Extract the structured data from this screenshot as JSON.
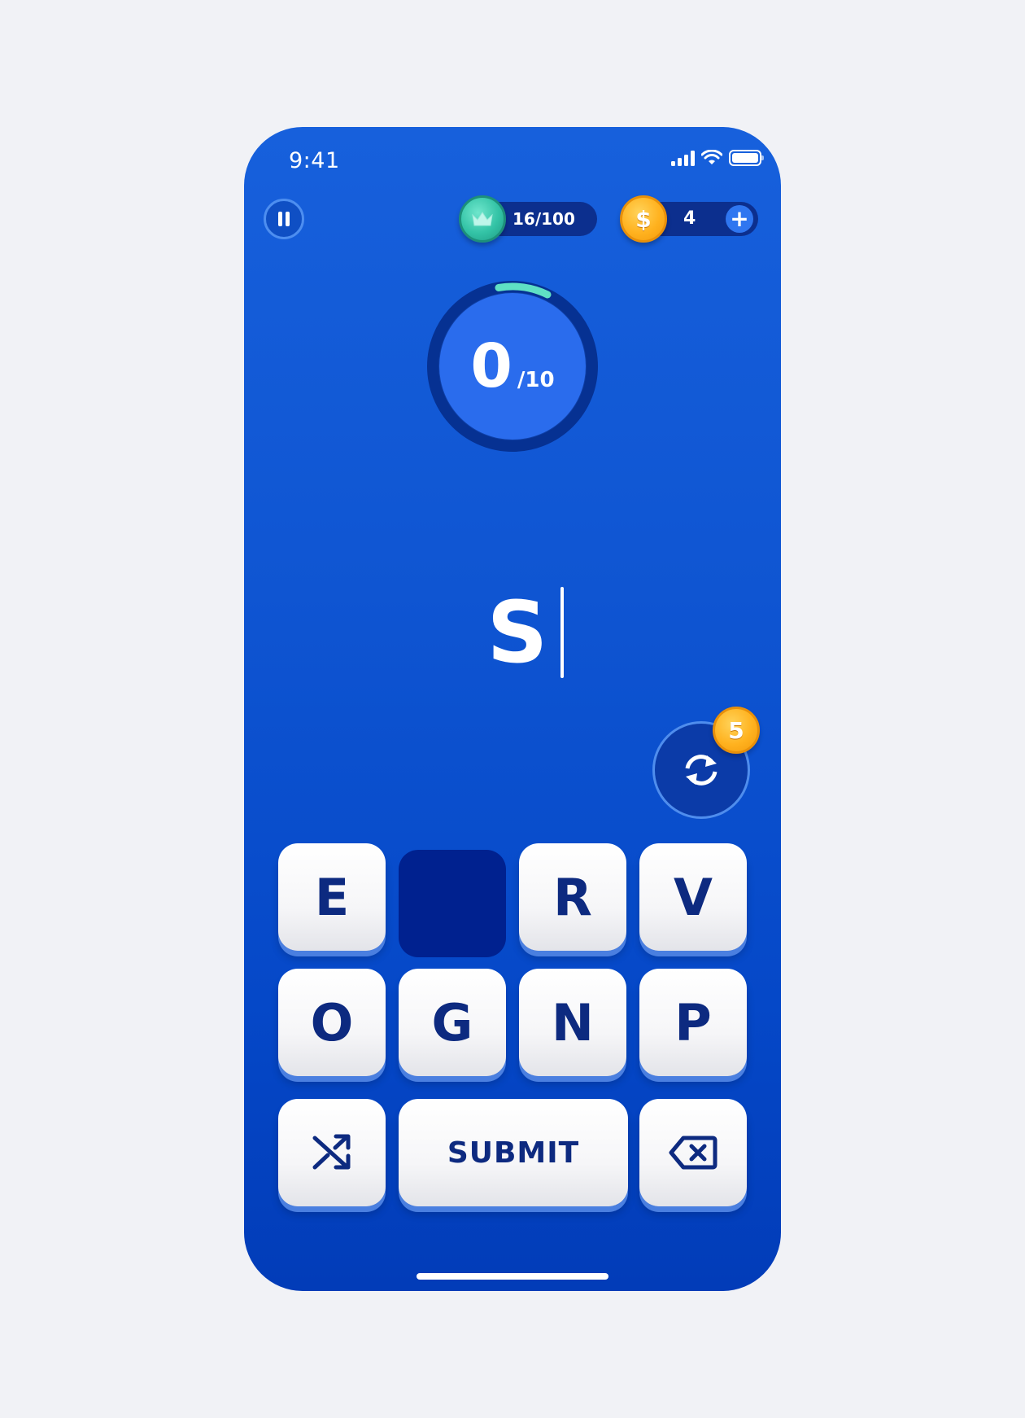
{
  "status_bar": {
    "time": "9:41"
  },
  "top_bar": {
    "progress": {
      "text": "16/100",
      "fraction": 0.16
    },
    "coins": {
      "count": "4",
      "coin_symbol": "$",
      "add_label": "+"
    }
  },
  "score": {
    "value": "0",
    "total": "/10",
    "ring_fraction": 0.1
  },
  "word": {
    "current": "S"
  },
  "refresh": {
    "cost": "5"
  },
  "tiles": {
    "row1": [
      "E",
      "",
      "R",
      "V"
    ],
    "row2": [
      "O",
      "G",
      "N",
      "P"
    ]
  },
  "actions": {
    "submit_label": "SUBMIT"
  },
  "colors": {
    "background": "#1157d4",
    "tile_text": "#0d2a80",
    "teal": "#33c3a6",
    "gold": "#ffb21f"
  }
}
